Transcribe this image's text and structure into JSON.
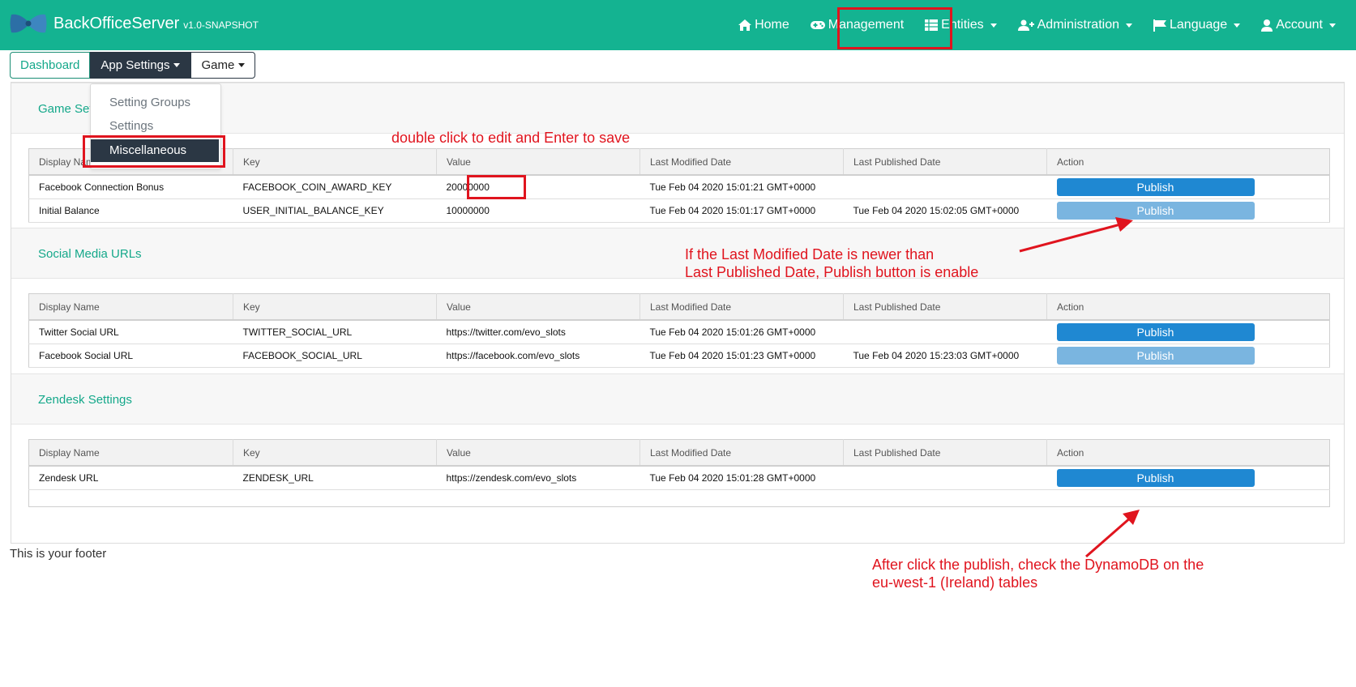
{
  "brand": {
    "name": "BackOfficeServer",
    "version": "v1.0-SNAPSHOT",
    "logo_icon": "bowtie-logo-icon"
  },
  "colors": {
    "navbar": "#14b391",
    "accent": "#14a88a",
    "annotation": "#e0141e",
    "publish_enabled": "#1f88d2",
    "publish_disabled": "#7ab5e0",
    "dark": "#2b3744"
  },
  "nav": {
    "home": "Home",
    "management": "Management",
    "entities": "Entities",
    "administration": "Administration",
    "language": "Language",
    "account": "Account"
  },
  "subnav": {
    "dashboard": "Dashboard",
    "app_settings": "App Settings",
    "game": "Game"
  },
  "dropdown": {
    "items": [
      "Setting Groups",
      "Settings",
      "Miscellaneous"
    ]
  },
  "columns": [
    "Display Name",
    "Key",
    "Value",
    "Last Modified Date",
    "Last Published Date",
    "Action"
  ],
  "sections": [
    {
      "title": "Game Settings",
      "rows": [
        {
          "display_name": "Facebook Connection Bonus",
          "key": "FACEBOOK_COIN_AWARD_KEY",
          "value": "20000000",
          "last_modified": "Tue Feb 04 2020 15:01:21 GMT+0000",
          "last_published": "",
          "action": "Publish",
          "enabled": true
        },
        {
          "display_name": "Initial Balance",
          "key": "USER_INITIAL_BALANCE_KEY",
          "value": "10000000",
          "last_modified": "Tue Feb 04 2020 15:01:17 GMT+0000",
          "last_published": "Tue Feb 04 2020 15:02:05 GMT+0000",
          "action": "Publish",
          "enabled": false
        }
      ]
    },
    {
      "title": "Social Media URLs",
      "rows": [
        {
          "display_name": "Twitter Social URL",
          "key": "TWITTER_SOCIAL_URL",
          "value": "https://twitter.com/evo_slots",
          "last_modified": "Tue Feb 04 2020 15:01:26 GMT+0000",
          "last_published": "",
          "action": "Publish",
          "enabled": true
        },
        {
          "display_name": "Facebook Social URL",
          "key": "FACEBOOK_SOCIAL_URL",
          "value": "https://facebook.com/evo_slots",
          "last_modified": "Tue Feb 04 2020 15:01:23 GMT+0000",
          "last_published": "Tue Feb 04 2020 15:23:03 GMT+0000",
          "action": "Publish",
          "enabled": false
        }
      ]
    },
    {
      "title": "Zendesk Settings",
      "rows": [
        {
          "display_name": "Zendesk URL",
          "key": "ZENDESK_URL",
          "value": "https://zendesk.com/evo_slots",
          "last_modified": "Tue Feb 04 2020 15:01:28 GMT+0000",
          "last_published": "",
          "action": "Publish",
          "enabled": true
        }
      ]
    }
  ],
  "annotations": {
    "edit_hint": "double click to edit and Enter to save",
    "publish_rule_line1": "If the Last Modified Date is newer than",
    "publish_rule_line2": "Last Published Date, Publish button is enable",
    "after_publish_line1": "After click the publish, check the DynamoDB on the",
    "after_publish_line2": "eu-west-1 (Ireland) tables"
  },
  "footer": "This is your footer"
}
